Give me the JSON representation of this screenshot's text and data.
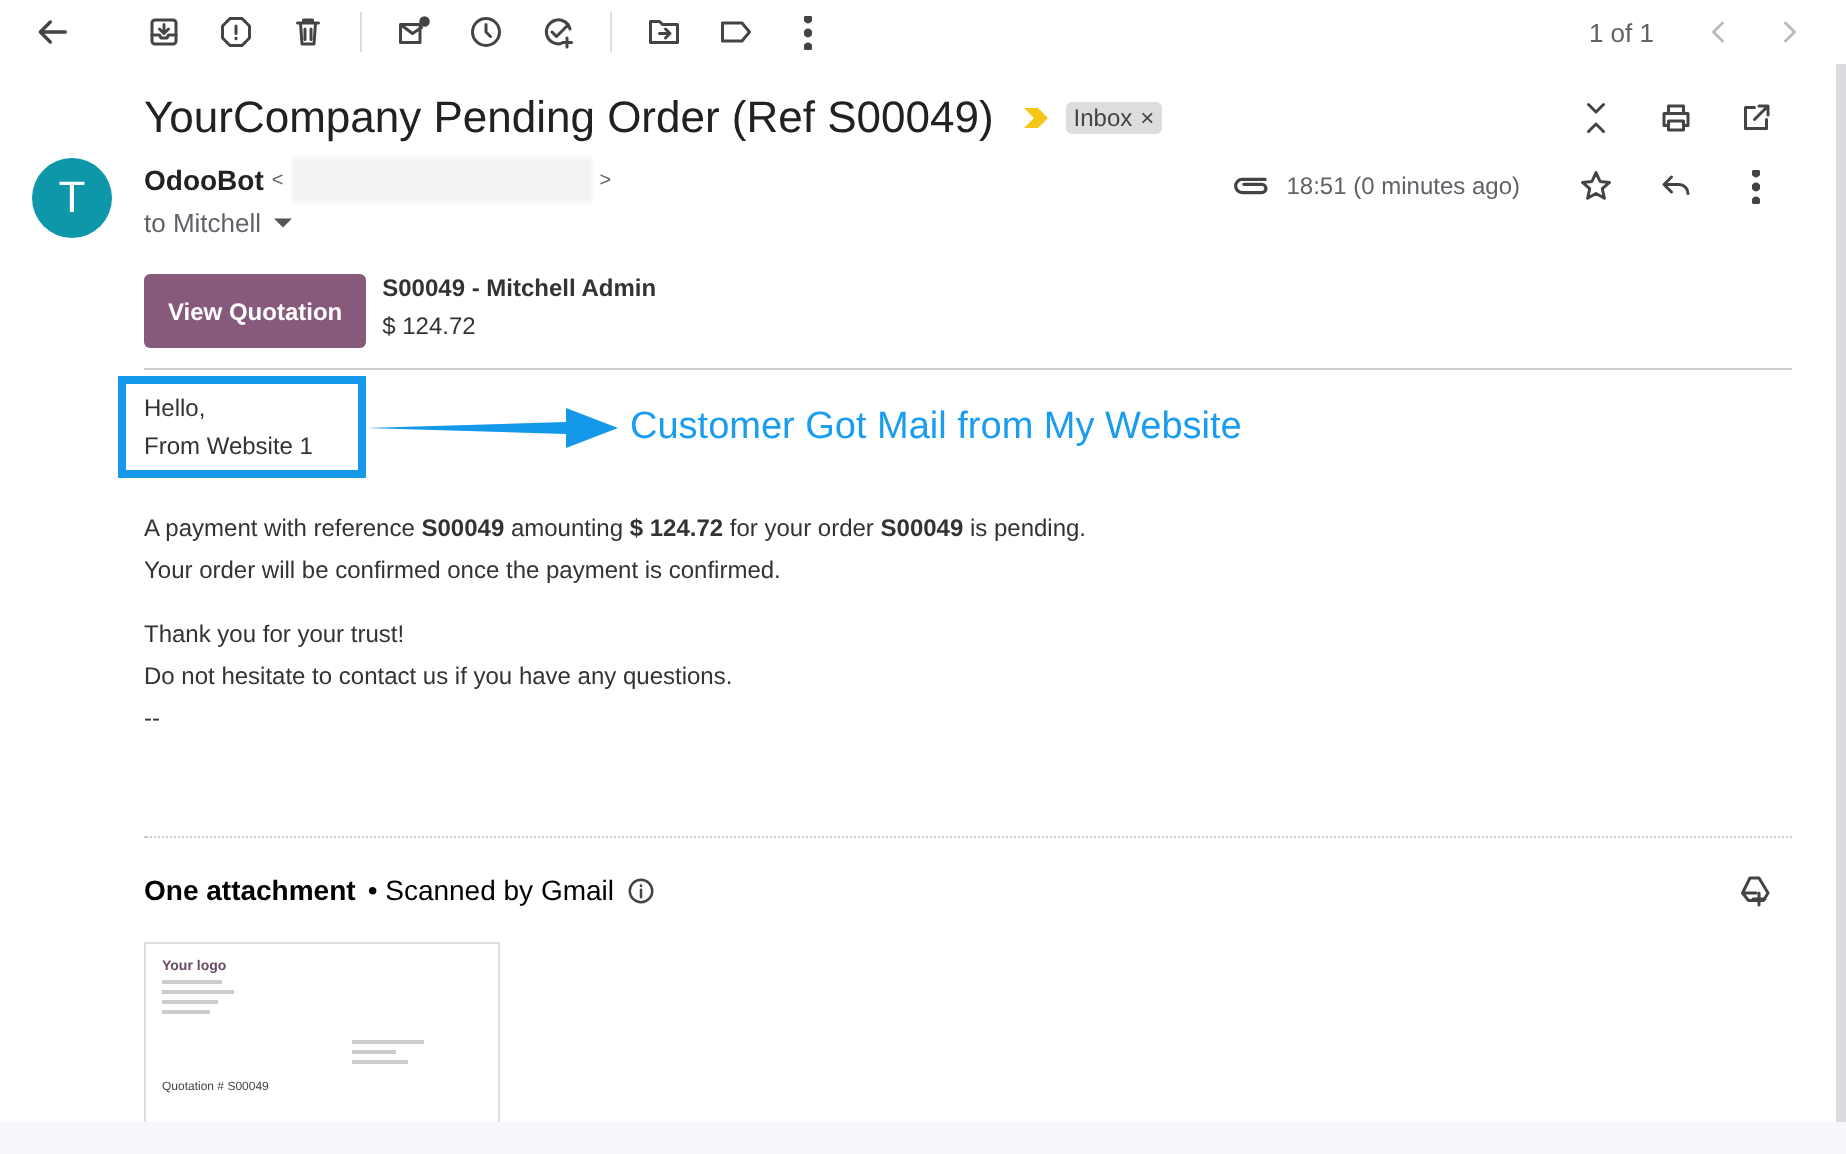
{
  "toolbar": {
    "pager": "1 of 1"
  },
  "subject": {
    "title": "YourCompany Pending Order (Ref S00049)",
    "important": true,
    "labels": [
      {
        "name": "Inbox",
        "remove": "×"
      }
    ]
  },
  "message": {
    "avatar": "T",
    "sender": "OdooBot",
    "email_open": "<",
    "email_close": ">",
    "recipient": "to Mitchell",
    "time": "18:51 (0 minutes ago)",
    "has_attachment": true,
    "starred": false
  },
  "quotation": {
    "button": "View Quotation",
    "reference": "S00049 - Mitchell Admin",
    "amount": "$ 124.72"
  },
  "greeting": [
    "Hello,",
    "From Website 1"
  ],
  "annotation": "Customer Got Mail from My Website",
  "paragraphs": [
    [
      "A payment with reference **S00049** amounting **$ 124.72** for your order **S00049** is pending.",
      "Your order will be confirmed once the payment is confirmed."
    ],
    [
      "Thank you for your trust!",
      "Do not hesitate to contact us if you have any questions.",
      "--"
    ]
  ],
  "attachments": {
    "title": "One attachment",
    "scan": "• Scanned by Gmail",
    "files": [
      {
        "logo": "Your logo",
        "heading": "Quotation # S00049"
      }
    ]
  }
}
